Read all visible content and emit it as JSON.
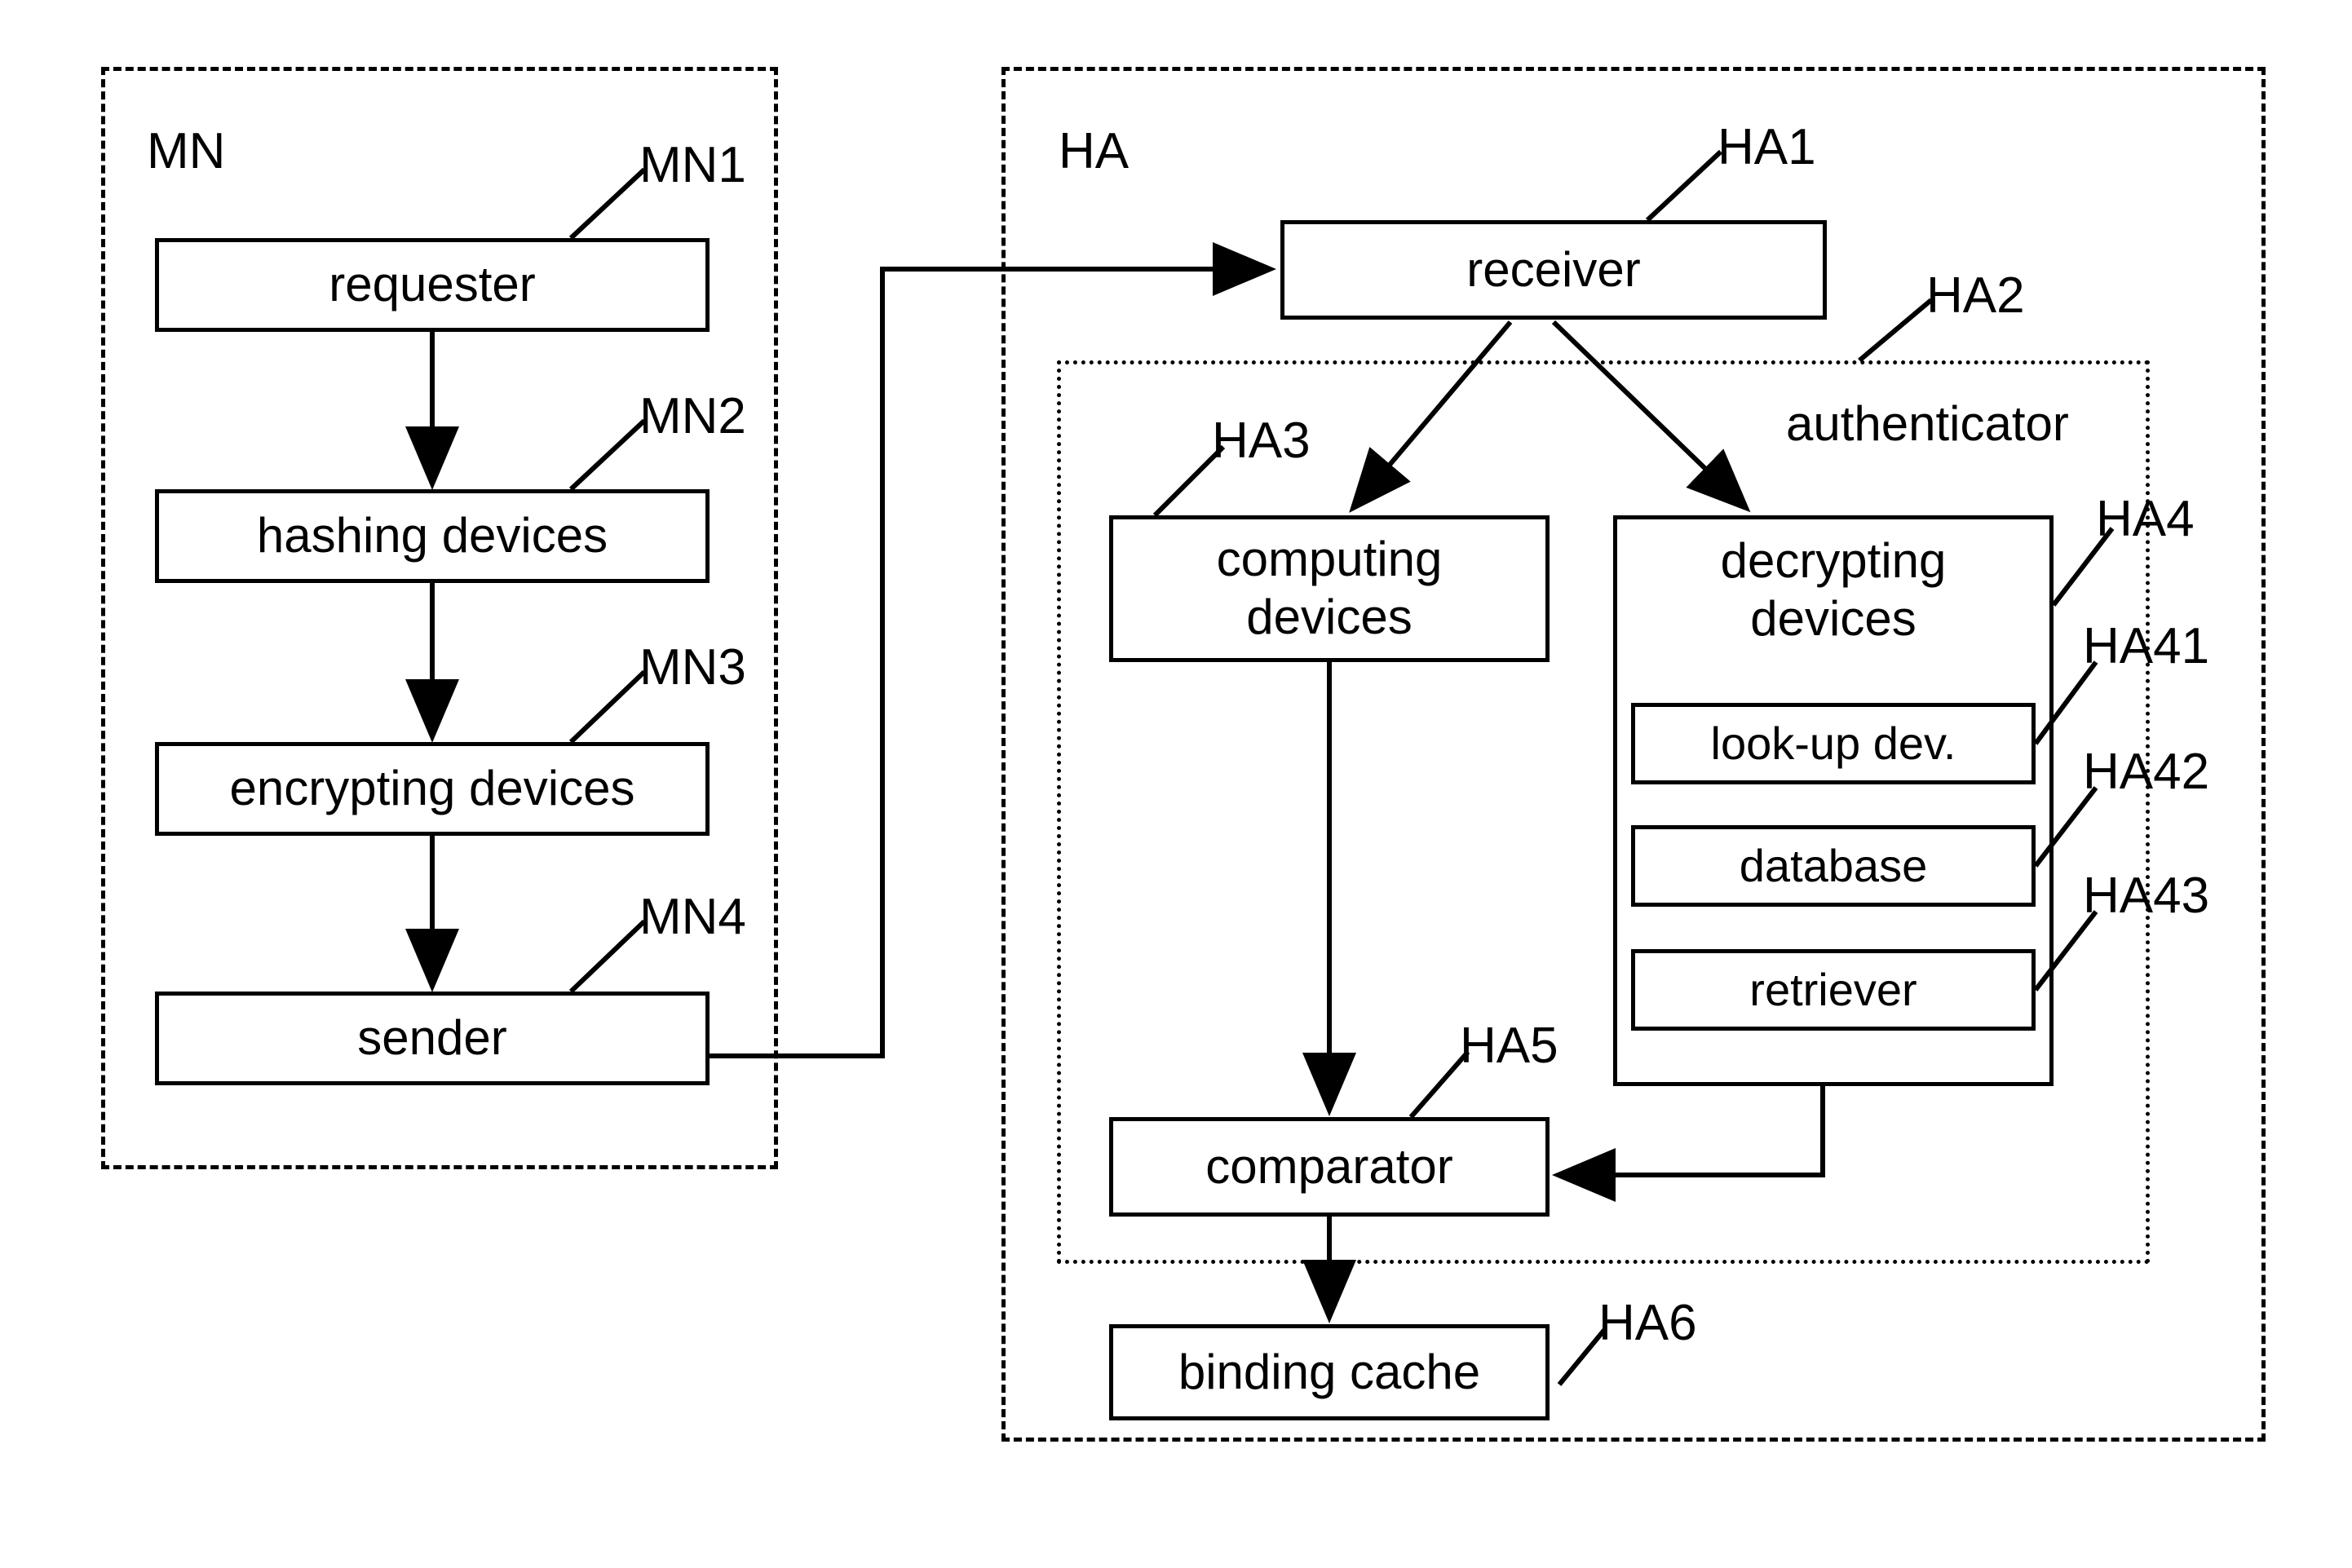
{
  "figure": {
    "type": "patent-block-diagram",
    "title": "",
    "background_color": "#ffffff",
    "line_color": "#000000"
  },
  "groups": [
    {
      "id": "MN",
      "label": "MN",
      "border": "dashed"
    },
    {
      "id": "HA",
      "label": "HA",
      "border": "dashed"
    },
    {
      "id": "HA2",
      "label": "authenticator",
      "border": "dotted"
    }
  ],
  "mn": {
    "group_label": "MN",
    "blocks": [
      {
        "ref": "MN1",
        "label": "requester"
      },
      {
        "ref": "MN2",
        "label": "hashing devices"
      },
      {
        "ref": "MN3",
        "label": "encrypting devices"
      },
      {
        "ref": "MN4",
        "label": "sender"
      }
    ]
  },
  "ha": {
    "group_label": "HA",
    "authenticator_label": "authenticator",
    "blocks": [
      {
        "ref": "HA1",
        "label": "receiver"
      },
      {
        "ref": "HA3",
        "label": "computing\ndevices"
      },
      {
        "ref": "HA4",
        "label": "decrypting\ndevices"
      },
      {
        "ref": "HA41",
        "label": "look-up dev."
      },
      {
        "ref": "HA42",
        "label": "database"
      },
      {
        "ref": "HA43",
        "label": "retriever"
      },
      {
        "ref": "HA5",
        "label": "comparator"
      },
      {
        "ref": "HA6",
        "label": "binding cache"
      }
    ]
  },
  "reference_numerals": {
    "MN1": "MN1",
    "MN2": "MN2",
    "MN3": "MN3",
    "MN4": "MN4",
    "HA1": "HA1",
    "HA2": "HA2",
    "HA3": "HA3",
    "HA4": "HA4",
    "HA41": "HA41",
    "HA42": "HA42",
    "HA43": "HA43",
    "HA5": "HA5",
    "HA6": "HA6"
  },
  "connections": [
    {
      "from": "requester",
      "to": "hashing devices",
      "style": "arrow-down"
    },
    {
      "from": "hashing devices",
      "to": "encrypting devices",
      "style": "arrow-down"
    },
    {
      "from": "encrypting devices",
      "to": "sender",
      "style": "arrow-down"
    },
    {
      "from": "sender",
      "to": "receiver",
      "style": "orthogonal-arrow-right"
    },
    {
      "from": "receiver",
      "to": "computing devices",
      "style": "arrow-diagonal"
    },
    {
      "from": "receiver",
      "to": "decrypting devices",
      "style": "arrow-diagonal"
    },
    {
      "from": "computing devices",
      "to": "comparator",
      "style": "arrow-down"
    },
    {
      "from": "decrypting devices",
      "to": "comparator",
      "style": "orthogonal-arrow-left"
    },
    {
      "from": "comparator",
      "to": "binding cache",
      "style": "arrow-down"
    }
  ]
}
